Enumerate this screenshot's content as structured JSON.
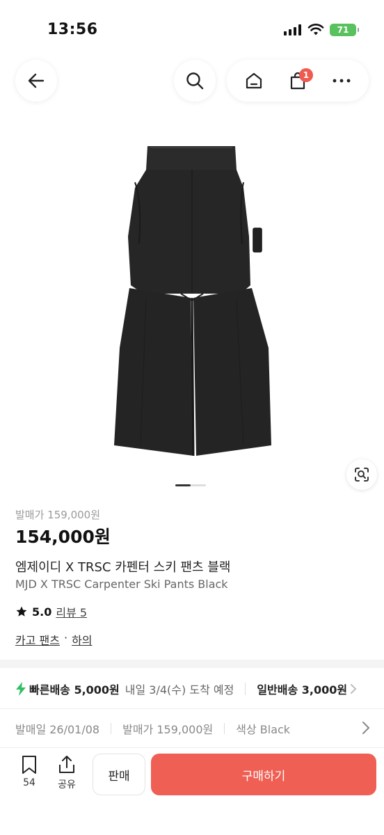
{
  "status_bar": {
    "time": "13:56",
    "battery": "71"
  },
  "header": {
    "cart_count": "1"
  },
  "product": {
    "release_price_label": "발매가 159,000원",
    "price": "154,000원",
    "title_ko": "엠제이디 X TRSC 카펜터 스키 팬츠 블랙",
    "title_en": "MJD X TRSC Carpenter Ski Pants Black",
    "rating": "5.0",
    "review_label": "리뷰 5",
    "category_main": "카고 팬츠",
    "category_sep": "·",
    "category_sub": "하의",
    "image": {
      "total": 2,
      "current": 1
    }
  },
  "shipping": {
    "fast_label": "빠른배송 5,000원",
    "fast_eta": "내일 3/4(수) 도착 예정",
    "normal_label": "일반배송 3,000원"
  },
  "meta": {
    "release_date": "발매일 26/01/08",
    "release_price": "발매가 159,000원",
    "color": "색상 Black"
  },
  "bottom_bar": {
    "wish_count": "54",
    "share_label": "공유",
    "sell_label": "판매",
    "buy_label": "구매하기"
  },
  "colors": {
    "accent": "#ef5f54",
    "badge": "#ef5b4e",
    "battery": "#5ac15f"
  },
  "icons": [
    "back-arrow-icon",
    "search-icon",
    "home-icon",
    "cart-icon",
    "more-icon",
    "lens-icon",
    "lightning-icon",
    "star-icon",
    "bookmark-icon",
    "share-icon",
    "chevron-right-icon",
    "signal-icon",
    "wifi-icon"
  ]
}
